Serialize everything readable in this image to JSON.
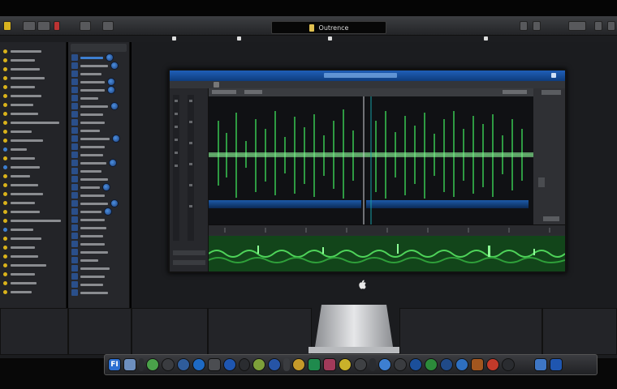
{
  "window": {
    "title": "Outrence",
    "lcd_icon": "app-icon"
  },
  "dock": {
    "first_icon_label": "FI"
  },
  "screen": {
    "colors": {
      "title_bar": "#1f5fb8",
      "waveform": "#3ee05a",
      "selection": "#1c5aa8",
      "track_green": "#2f9a35"
    }
  },
  "icons": [
    "apple-logo-icon",
    "folder-icon",
    "mail-icon",
    "music-icon",
    "settings-icon",
    "trash-icon"
  ]
}
